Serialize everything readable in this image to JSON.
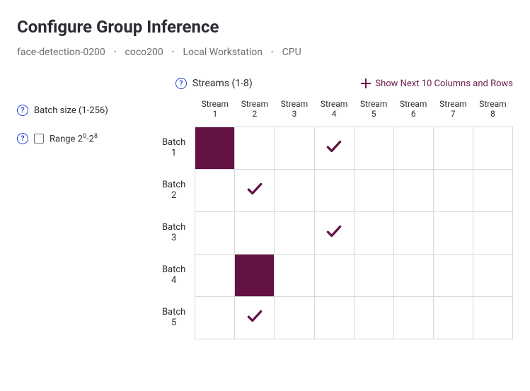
{
  "title": "Configure Group Inference",
  "breadcrumb": [
    "face-detection-0200",
    "coco200",
    "Local Workstation",
    "CPU"
  ],
  "streams": {
    "header_label": "Streams (1-8)",
    "columns": [
      {
        "line1": "Stream",
        "line2": "1"
      },
      {
        "line1": "Stream",
        "line2": "2"
      },
      {
        "line1": "Stream",
        "line2": "3"
      },
      {
        "line1": "Stream",
        "line2": "4"
      },
      {
        "line1": "Stream",
        "line2": "5"
      },
      {
        "line1": "Stream",
        "line2": "6"
      },
      {
        "line1": "Stream",
        "line2": "7"
      },
      {
        "line1": "Stream",
        "line2": "8"
      }
    ]
  },
  "batches": {
    "side_label": "Batch size (1-256)",
    "range_label_prefix": "Range 2",
    "range_label_sup1": "0",
    "range_label_mid": "-2",
    "range_label_sup2": "8",
    "rows": [
      {
        "line1": "Batch",
        "line2": "1"
      },
      {
        "line1": "Batch",
        "line2": "2"
      },
      {
        "line1": "Batch",
        "line2": "3"
      },
      {
        "line1": "Batch",
        "line2": "4"
      },
      {
        "line1": "Batch",
        "line2": "5"
      }
    ]
  },
  "show_next_label": "Show Next 10 Columns and Rows",
  "cells": [
    [
      "filled",
      "",
      "",
      "check",
      "",
      "",
      "",
      ""
    ],
    [
      "",
      "check",
      "",
      "",
      "",
      "",
      "",
      ""
    ],
    [
      "",
      "",
      "",
      "check",
      "",
      "",
      "",
      ""
    ],
    [
      "",
      "filled",
      "",
      "",
      "",
      "",
      "",
      ""
    ],
    [
      "",
      "check",
      "",
      "",
      "",
      "",
      "",
      ""
    ]
  ],
  "colors": {
    "accent": "#641243",
    "link": "#2a3fd4"
  }
}
